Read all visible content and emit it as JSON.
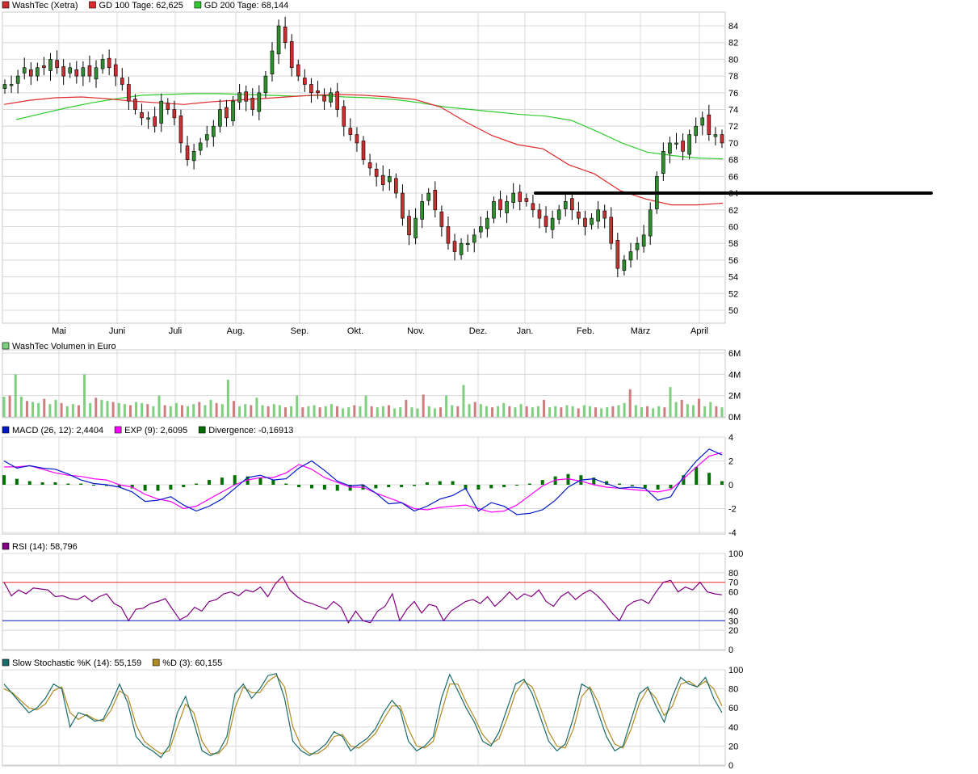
{
  "colors": {
    "price_candle_up": "#2f8f2f",
    "price_candle_down": "#cc2f2f",
    "gd100": "#e0282c",
    "gd200": "#2ecc2e",
    "volume_up": "#7ecf7e",
    "volume_down": "#cf7e7e",
    "macd": "#0018c8",
    "exp": "#ff00ff",
    "divergence": "#007000",
    "rsi": "#800080",
    "rsi_70": "#e0282c",
    "rsi_30": "#0018c8",
    "stoch_k": "#1a6a6a",
    "stoch_d": "#b08a20",
    "grid": "#d8d8d8",
    "hline": "#000000"
  },
  "legends": {
    "price": {
      "a": "WashTec (Xetra)",
      "b": "GD 100 Tage: 62,625",
      "c": "GD 200 Tage: 68,144"
    },
    "volume": {
      "a": "WashTec Volumen in Euro"
    },
    "macd": {
      "a": "MACD (26, 12): 2,4404",
      "b": "EXP (9): 2,6095",
      "c": "Divergence: -0,16913"
    },
    "rsi": {
      "a": "RSI (14): 58,796"
    },
    "stoch": {
      "a": "Slow Stochastic %K (14): 55,159",
      "b": "%D (3): 60,155"
    }
  },
  "chart_data": [
    {
      "type": "candlestick",
      "title": "WashTec (Xetra)",
      "x_labels": [
        "Mai",
        "Juni",
        "Juli",
        "Aug.",
        "Sep.",
        "Okt.",
        "Nov.",
        "Dez.",
        "Jan.",
        "Feb.",
        "März",
        "April"
      ],
      "y_ticks": [
        "50",
        "52",
        "54",
        "56",
        "58",
        "60",
        "62",
        "64",
        "66",
        "68",
        "70",
        "72",
        "74",
        "76",
        "78",
        "80",
        "82",
        "84"
      ],
      "ylim": [
        48.5,
        85.5
      ],
      "close": [
        77,
        77,
        78,
        79,
        78,
        79,
        79,
        80,
        79,
        78,
        79,
        78,
        79,
        78,
        79,
        80,
        79,
        78,
        77,
        75,
        74,
        73,
        73,
        72,
        75,
        74,
        73,
        70,
        68,
        69,
        70,
        71,
        72,
        74,
        73,
        75,
        76,
        75,
        74,
        76,
        78,
        81,
        84,
        82,
        79,
        78,
        77,
        76,
        76,
        75,
        76,
        74,
        72,
        71,
        70,
        68,
        67,
        66,
        65,
        66,
        64,
        61,
        59,
        61,
        63,
        64,
        62,
        60,
        58,
        57,
        58,
        58,
        59,
        60,
        61,
        63,
        62,
        63,
        64,
        63,
        63,
        62,
        61,
        60,
        61,
        62,
        63,
        62,
        61,
        60,
        61,
        62,
        61,
        58,
        55,
        56,
        57,
        58,
        59,
        62,
        66,
        69,
        70,
        70,
        69,
        71,
        72,
        73,
        71,
        71,
        70
      ],
      "gd100": [
        74.6,
        75.1,
        75.4,
        75.5,
        75.3,
        75.0,
        74.8,
        74.6,
        74.9,
        75.1,
        75.3,
        75.5,
        75.7,
        75.8,
        75.7,
        75.5,
        75.2,
        74.3,
        72.5,
        70.9,
        69.8,
        69.3,
        67.4,
        66.3,
        64.3,
        63.3,
        62.6,
        62.6,
        62.8
      ],
      "gd200": [
        72.8,
        73.5,
        74.2,
        74.8,
        75.3,
        75.7,
        75.8,
        75.9,
        75.9,
        75.8,
        75.7,
        75.6,
        75.7,
        75.5,
        75.4,
        75.2,
        74.8,
        74.3,
        74.0,
        73.7,
        73.4,
        73.2,
        72.7,
        71.4,
        70.0,
        68.9,
        68.5,
        68.2,
        68.1
      ],
      "hline_level": 64
    },
    {
      "type": "bar",
      "title": "WashTec Volumen in Euro",
      "y_ticks": [
        "0M",
        "2M",
        "4M",
        "6M"
      ],
      "ylim": [
        0,
        6.2
      ],
      "values": [
        1.9,
        2.0,
        4.0,
        1.9,
        1.5,
        1.4,
        1.3,
        1.7,
        1.2,
        1.6,
        1.3,
        1.0,
        1.2,
        1.1,
        4.0,
        1.3,
        1.8,
        1.6,
        1.5,
        1.4,
        1.3,
        1.2,
        1.1,
        1.4,
        1.3,
        1.2,
        1.0,
        2.0,
        1.1,
        1.0,
        1.3,
        1.1,
        1.0,
        1.2,
        1.4,
        1.1,
        1.6,
        1.3,
        1.2,
        3.5,
        1.5,
        1.0,
        1.2,
        1.1,
        1.8,
        1.1,
        1.0,
        1.2,
        1.1,
        0.9,
        1.0,
        2.0,
        0.9,
        1.0,
        1.1,
        0.9,
        1.0,
        1.2,
        1.0,
        0.8,
        0.9,
        1.1,
        1.0,
        2.0,
        1.0,
        0.9,
        1.0,
        1.1,
        0.8,
        0.9,
        1.6,
        0.9,
        0.8,
        2.1,
        1.0,
        0.8,
        0.9,
        2.0,
        1.1,
        1.0,
        3.0,
        1.2,
        1.4,
        1.2,
        1.0,
        0.9,
        1.0,
        1.3,
        1.0,
        0.9,
        1.2,
        1.0,
        0.9,
        1.0,
        1.6,
        0.9,
        1.0,
        0.9,
        1.1,
        1.0,
        0.8,
        1.1,
        1.0,
        0.9,
        0.8,
        0.9,
        1.0,
        1.1,
        1.3,
        2.6,
        1.1,
        0.9,
        1.0,
        0.8,
        1.0,
        0.9,
        2.8,
        1.4,
        1.6,
        1.2,
        1.1,
        1.7,
        1.0,
        1.4,
        1.0,
        0.9
      ]
    },
    {
      "type": "line",
      "title": "MACD (26, 12)",
      "y_ticks": [
        "-4",
        "-2",
        "0",
        "2",
        "4"
      ],
      "ylim": [
        -4,
        4
      ],
      "macd": [
        2.0,
        1.4,
        1.6,
        1.4,
        1.3,
        0.9,
        0.4,
        0.1,
        0.0,
        -0.2,
        -0.6,
        -1.4,
        -1.3,
        -1.0,
        -1.7,
        -2.2,
        -1.8,
        -1.2,
        -0.3,
        0.6,
        0.8,
        0.4,
        0.5,
        1.4,
        2.0,
        1.2,
        0.3,
        -0.1,
        0.0,
        -0.7,
        -1.6,
        -1.5,
        -2.2,
        -1.8,
        -1.2,
        -0.9,
        -0.3,
        -2.2,
        -1.5,
        -1.8,
        -2.5,
        -2.4,
        -2.1,
        -1.3,
        -0.2,
        0.4,
        0.5,
        0.1,
        -0.3,
        -0.2,
        -0.3,
        -1.3,
        -1.0,
        0.7,
        2.0,
        3.0,
        2.5
      ],
      "exp": [
        1.5,
        1.5,
        1.6,
        1.3,
        1.0,
        0.8,
        0.7,
        0.5,
        0.4,
        0.0,
        -0.2,
        -0.8,
        -1.2,
        -1.4,
        -2.0,
        -1.8,
        -1.2,
        -0.6,
        0.0,
        0.4,
        0.6,
        0.6,
        1.0,
        1.7,
        1.3,
        0.6,
        0.2,
        -0.2,
        -0.2,
        -0.7,
        -1.1,
        -1.5,
        -2.0,
        -2.1,
        -1.9,
        -1.8,
        -1.7,
        -2.0,
        -2.3,
        -2.2,
        -1.7,
        -0.9,
        -0.1,
        0.4,
        0.5,
        0.3,
        0.0,
        -0.2,
        -0.3,
        -0.4,
        -0.5,
        -0.6,
        -0.4,
        0.5,
        1.5,
        2.4,
        2.7
      ],
      "divergence": [
        0.8,
        0.5,
        0.3,
        0.2,
        0.2,
        0.1,
        0.1,
        0.0,
        -0.1,
        -0.2,
        -0.3,
        -0.5,
        -0.5,
        -0.4,
        -0.2,
        0.1,
        0.4,
        0.6,
        0.8,
        0.7,
        0.6,
        0.4,
        0.1,
        -0.2,
        -0.3,
        -0.4,
        -0.5,
        -0.5,
        -0.4,
        -0.3,
        -0.2,
        -0.2,
        -0.1,
        0.2,
        0.3,
        0.3,
        -0.4,
        -0.4,
        -0.3,
        -0.2,
        0.0,
        0.1,
        0.4,
        0.7,
        0.9,
        0.8,
        0.6,
        0.3,
        0.1,
        -0.1,
        -0.3,
        -0.4,
        -0.3,
        0.8,
        1.5,
        1.0,
        0.3
      ]
    },
    {
      "type": "line",
      "title": "RSI (14)",
      "y_ticks": [
        "0",
        "20",
        "30",
        "40",
        "60",
        "70",
        "80",
        "100"
      ],
      "ylim": [
        0,
        100
      ],
      "levels": [
        70,
        30
      ],
      "values": [
        70,
        56,
        62,
        58,
        64,
        63,
        62,
        55,
        56,
        53,
        52,
        56,
        50,
        55,
        58,
        48,
        44,
        30,
        42,
        43,
        48,
        50,
        53,
        42,
        31,
        35,
        44,
        40,
        50,
        52,
        58,
        60,
        56,
        62,
        60,
        65,
        55,
        68,
        76,
        62,
        55,
        50,
        48,
        45,
        42,
        50,
        44,
        28,
        40,
        30,
        28,
        40,
        45,
        58,
        30,
        42,
        50,
        38,
        47,
        45,
        30,
        40,
        45,
        50,
        52,
        48,
        55,
        45,
        52,
        60,
        52,
        58,
        55,
        62,
        50,
        45,
        55,
        60,
        52,
        58,
        62,
        56,
        48,
        38,
        30,
        45,
        50,
        52,
        48,
        60,
        70,
        72,
        60,
        65,
        62,
        70,
        60,
        58,
        57
      ]
    },
    {
      "type": "line",
      "title": "Slow Stochastic %K (14)",
      "y_ticks": [
        "0",
        "20",
        "40",
        "60",
        "80",
        "100"
      ],
      "ylim": [
        0,
        100
      ],
      "k": [
        85,
        75,
        65,
        55,
        60,
        70,
        85,
        80,
        40,
        55,
        52,
        46,
        48,
        65,
        85,
        65,
        30,
        20,
        15,
        8,
        20,
        55,
        72,
        45,
        15,
        10,
        14,
        30,
        75,
        85,
        70,
        80,
        94,
        96,
        70,
        25,
        15,
        10,
        15,
        22,
        35,
        30,
        15,
        22,
        28,
        38,
        55,
        68,
        58,
        25,
        15,
        20,
        30,
        70,
        95,
        78,
        60,
        45,
        25,
        20,
        35,
        60,
        85,
        90,
        75,
        50,
        25,
        15,
        22,
        50,
        85,
        80,
        55,
        30,
        15,
        20,
        48,
        75,
        82,
        62,
        45,
        72,
        92,
        85,
        82,
        92,
        70,
        55
      ],
      "d": [
        80,
        76,
        68,
        60,
        58,
        64,
        78,
        82,
        55,
        48,
        53,
        48,
        46,
        58,
        78,
        72,
        42,
        25,
        18,
        12,
        15,
        40,
        64,
        55,
        25,
        12,
        12,
        22,
        60,
        82,
        76,
        76,
        88,
        94,
        82,
        40,
        20,
        12,
        12,
        18,
        30,
        32,
        20,
        18,
        25,
        33,
        48,
        62,
        62,
        38,
        20,
        18,
        25,
        55,
        85,
        85,
        66,
        50,
        32,
        22,
        28,
        50,
        76,
        88,
        82,
        60,
        35,
        20,
        18,
        38,
        72,
        82,
        66,
        40,
        22,
        18,
        38,
        65,
        80,
        70,
        52,
        62,
        85,
        88,
        82,
        88,
        80,
        62
      ]
    }
  ]
}
